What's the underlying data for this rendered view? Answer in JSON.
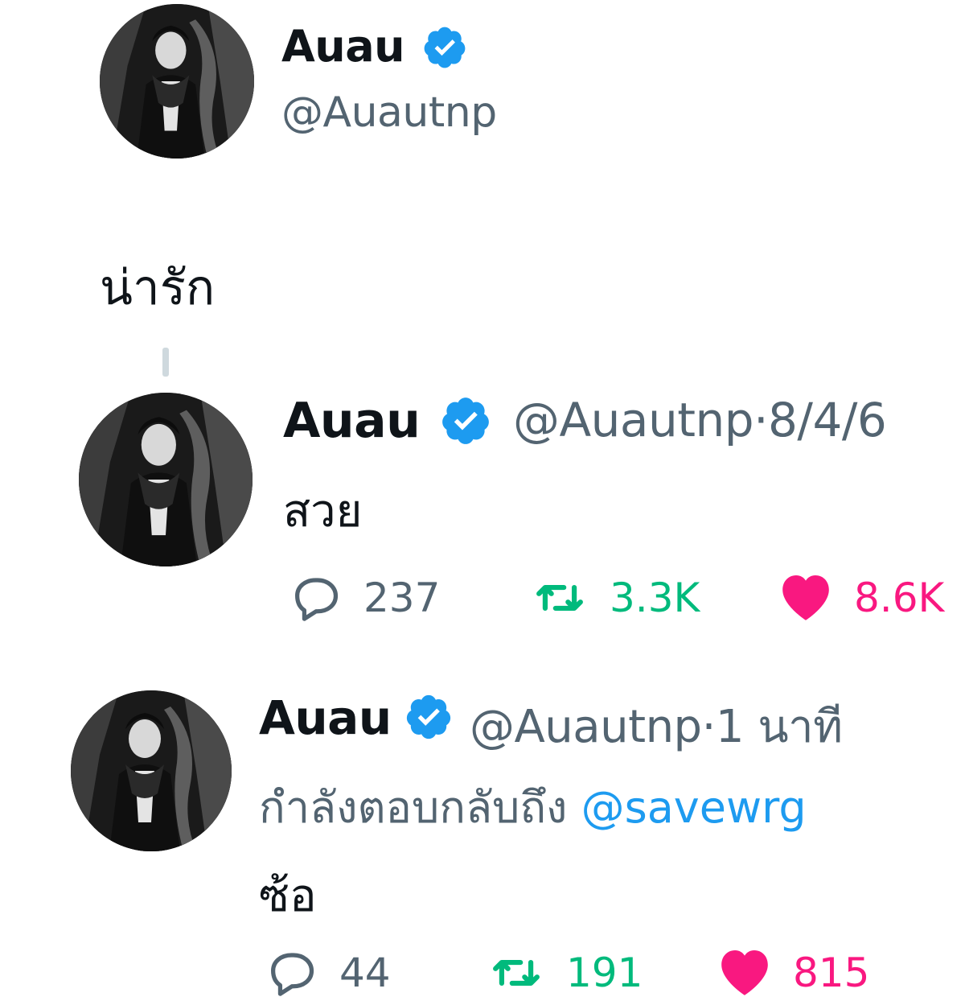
{
  "colors": {
    "text": "#0f1419",
    "muted": "#536471",
    "verified": "#1d9bf0",
    "retweet": "#00ba7c",
    "like": "#f91880",
    "thread_line": "#cfd9de"
  },
  "main_tweet": {
    "author_name": "Auau",
    "handle": "@Auautnp",
    "verified": true,
    "text": "น่ารัก"
  },
  "reply_1": {
    "author_name": "Auau",
    "handle": "@Auautnp",
    "separator": "·",
    "date": "8/4/6",
    "verified": true,
    "text": "สวย",
    "actions": {
      "reply_count": "237",
      "retweet_count": "3.3K",
      "like_count": "8.6K",
      "liked": true
    }
  },
  "reply_2": {
    "author_name": "Auau",
    "handle": "@Auautnp",
    "separator": "·",
    "date": "1 นาที",
    "verified": true,
    "replying_to_label": "กำลังตอบกลับถึง",
    "replying_to_handle": "@savewrg",
    "text": "ซ้อ",
    "actions": {
      "reply_count": "44",
      "retweet_count": "191",
      "like_count": "815",
      "liked": true
    }
  },
  "icons": [
    "verified-badge-icon",
    "reply-icon",
    "retweet-icon",
    "like-icon"
  ]
}
